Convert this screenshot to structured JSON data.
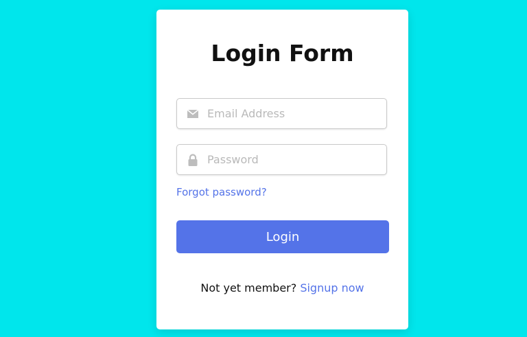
{
  "page": {
    "background_color": "#00E6EC",
    "accent_color": "#5473E8"
  },
  "form": {
    "title": "Login Form",
    "email": {
      "icon": "envelope-icon",
      "placeholder": "Email Address",
      "value": ""
    },
    "password": {
      "icon": "lock-icon",
      "placeholder": "Password",
      "value": ""
    },
    "forgot_label": "Forgot password?",
    "login_label": "Login",
    "signup_prompt": "Not yet member?",
    "signup_link_label": "Signup now"
  }
}
